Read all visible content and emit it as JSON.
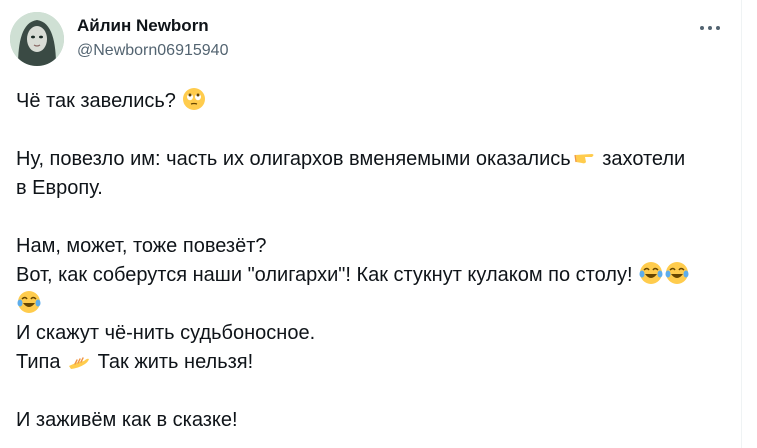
{
  "author": {
    "display_name": "Айлин Newborn",
    "handle": "@Newborn06915940"
  },
  "icons": {
    "more": "more-horizontal-icon",
    "eye_roll": "face-with-rolling-eyes-emoji",
    "point_right": "backhand-index-pointing-right-emoji",
    "tears_of_joy": "face-with-tears-of-joy-emoji",
    "palm_up": "palm-up-hand-emoji"
  },
  "tweet": {
    "line1": "Чё так завелись?",
    "line2a": "Ну, повезло им: часть их олигархов вменяемыми оказались",
    "line2b": " захотели",
    "line2c": "в Европу.",
    "line3": "Нам, может, тоже повезёт?",
    "line4": "Вот, как соберутся наши \"олигархи\"! Как стукнут кулаком по столу!",
    "line5": "И скажут чё-нить судьбоносное.",
    "line6a": "Типа",
    "line6b": "Так жить нельзя!",
    "line7": "И заживём как в сказке!"
  }
}
